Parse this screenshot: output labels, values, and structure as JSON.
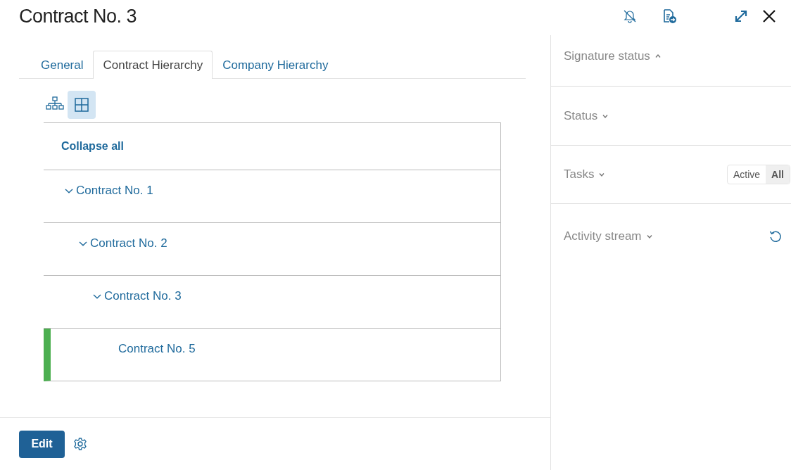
{
  "title": "Contract No. 3",
  "tabs": [
    {
      "label": "General",
      "selected": false
    },
    {
      "label": "Contract Hierarchy",
      "selected": true
    },
    {
      "label": "Company Hierarchy",
      "selected": false
    }
  ],
  "view_modes": [
    {
      "kind": "tree",
      "selected": false
    },
    {
      "kind": "grid",
      "selected": true
    }
  ],
  "tree": {
    "collapse_label": "Collapse all",
    "items": [
      {
        "label": "Contract No. 1",
        "expanded": true,
        "selected": false,
        "children": [
          {
            "label": "Contract No. 2",
            "expanded": true,
            "selected": false,
            "children": [
              {
                "label": "Contract No. 3",
                "expanded": true,
                "selected": false,
                "children": [
                  {
                    "label": "Contract No. 5",
                    "selected": true
                  }
                ]
              }
            ]
          }
        ]
      }
    ]
  },
  "edit_button": "Edit",
  "sidebar": {
    "sections": [
      {
        "kind": "plain",
        "title": "Signature status",
        "expanded": true
      },
      {
        "kind": "plain",
        "title": "Status",
        "expanded": false
      },
      {
        "kind": "filters",
        "title": "Tasks",
        "expanded": false,
        "filters": [
          {
            "label": "Active",
            "selected": false
          },
          {
            "label": "All",
            "selected": true
          }
        ]
      },
      {
        "kind": "refresh",
        "title": "Activity stream",
        "expanded": false
      }
    ]
  }
}
